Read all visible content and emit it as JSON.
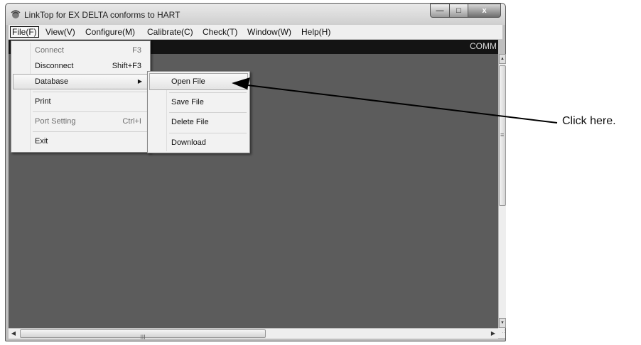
{
  "window": {
    "title": "LinkTop for EX DELTA conforms to HART",
    "status_text": "COMM"
  },
  "controls": {
    "minimize": "—",
    "maximize": "□",
    "close": "x"
  },
  "menubar": [
    {
      "label": "File(F)"
    },
    {
      "label": "View(V)"
    },
    {
      "label": "Configure(M)"
    },
    {
      "label": "Calibrate(C)"
    },
    {
      "label": "Check(T)"
    },
    {
      "label": "Window(W)"
    },
    {
      "label": "Help(H)"
    }
  ],
  "file_menu": [
    {
      "label": "Connect",
      "shortcut": "F3",
      "disabled": true
    },
    {
      "label": "Disconnect",
      "shortcut": "Shift+F3",
      "disabled": false
    },
    {
      "label": "Database",
      "shortcut": "",
      "disabled": false,
      "submenu": true
    },
    {
      "label": "Print",
      "shortcut": "",
      "disabled": false
    },
    {
      "label": "Port Setting",
      "shortcut": "Ctrl+I",
      "disabled": true
    },
    {
      "label": "Exit",
      "shortcut": "",
      "disabled": false
    }
  ],
  "database_submenu": [
    {
      "label": "Open File"
    },
    {
      "label": "Save File"
    },
    {
      "label": "Delete File"
    },
    {
      "label": "Download"
    }
  ],
  "scrollbar": {
    "hgrip": "III",
    "vgrip": "≡"
  },
  "annotation": {
    "text": "Click here.",
    "color": "#111111"
  },
  "colors": {
    "client_bg": "#5c5c5c",
    "top_band": "#141414",
    "menu_bg": "#f2f2f2"
  }
}
